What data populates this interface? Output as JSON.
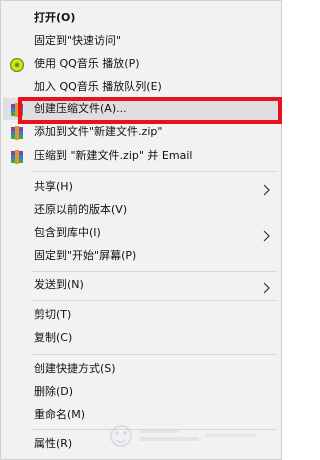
{
  "context_menu": {
    "items": [
      {
        "label": "打开(O)",
        "bold": true
      },
      {
        "label": "固定到\"快速访问\""
      },
      {
        "label": "使用 QQ音乐 播放(P)",
        "icon": "qq-music-icon"
      },
      {
        "label": "加入 QQ音乐 播放队列(E)"
      },
      {
        "label": "创建压缩文件(A)...",
        "icon": "winrar-icon",
        "highlighted": true
      },
      {
        "label": "添加到文件\"新建文件.zip\"",
        "icon": "winrar-icon"
      },
      {
        "label": "压缩到 \"新建文件.zip\" 并 Email",
        "icon": "winrar-icon"
      },
      {
        "label": "共享(H)",
        "submenu": true
      },
      {
        "label": "还原以前的版本(V)"
      },
      {
        "label": "包含到库中(I)",
        "submenu": true
      },
      {
        "label": "固定到\"开始\"屏幕(P)"
      },
      {
        "label": "发送到(N)",
        "submenu": true
      },
      {
        "label": "剪切(T)"
      },
      {
        "label": "复制(C)"
      },
      {
        "label": "创建快捷方式(S)"
      },
      {
        "label": "删除(D)"
      },
      {
        "label": "重命名(M)"
      },
      {
        "label": "属性(R)"
      }
    ]
  },
  "colors": {
    "menu_background": "#f2f2f2",
    "hover_background": "#dfdfdf",
    "annotation_red": "#e8121c"
  }
}
